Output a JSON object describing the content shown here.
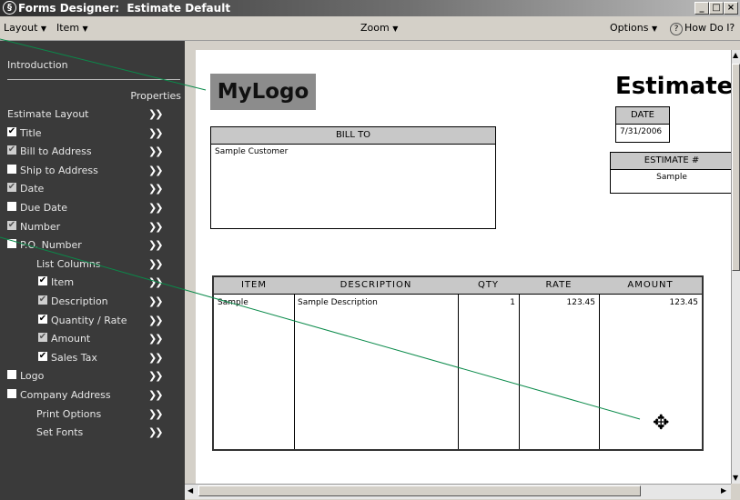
{
  "window": {
    "title": "Forms Designer:  Estimate Default",
    "min": "_",
    "max": "□",
    "close": "×"
  },
  "menubar": {
    "layout": "Layout",
    "item": "Item",
    "zoom": "Zoom",
    "options": "Options",
    "help": "How Do I?"
  },
  "sidebar": {
    "intro": "Introduction",
    "properties": "Properties",
    "items": [
      {
        "label": "Estimate Layout",
        "check": "none"
      },
      {
        "label": "Title",
        "check": "on"
      },
      {
        "label": "Bill to Address",
        "check": "dim"
      },
      {
        "label": "Ship to Address",
        "check": "off"
      },
      {
        "label": "Date",
        "check": "dim"
      },
      {
        "label": "Due Date",
        "check": "off"
      },
      {
        "label": "Number",
        "check": "dim"
      },
      {
        "label": "P.O. Number",
        "check": "off"
      },
      {
        "label": "List Columns",
        "check": "none"
      },
      {
        "label": "Item",
        "check": "on"
      },
      {
        "label": "Description",
        "check": "dim"
      },
      {
        "label": "Quantity / Rate",
        "check": "on"
      },
      {
        "label": "Amount",
        "check": "dim"
      },
      {
        "label": "Sales Tax",
        "check": "on"
      },
      {
        "label": "Logo",
        "check": "off"
      },
      {
        "label": "Company Address",
        "check": "off"
      },
      {
        "label": "Print Options",
        "check": "none"
      },
      {
        "label": "Set Fonts",
        "check": "none"
      }
    ]
  },
  "form": {
    "logo": "MyLogo",
    "title": "Estimate",
    "date_label": "DATE",
    "date_value": "7/31/2006",
    "estnum_label": "ESTIMATE #",
    "estnum_value": "Sample",
    "billto_label": "BILL TO",
    "billto_value": "Sample Customer",
    "columns": [
      {
        "label": "ITEM",
        "value": "Sample",
        "align": "left"
      },
      {
        "label": "DESCRIPTION",
        "value": "Sample Description",
        "align": "left"
      },
      {
        "label": "QTY",
        "value": "1",
        "align": "right"
      },
      {
        "label": "RATE",
        "value": "123.45",
        "align": "right"
      },
      {
        "label": "AMOUNT",
        "value": "123.45",
        "align": "right"
      }
    ]
  },
  "colors": {
    "sidebar_bg": "#3a3a3a",
    "header_fill": "#c8c8c8",
    "logo_fill": "#8c8c8c",
    "pointer_line": "#0a8a4a"
  },
  "icons": {
    "app": "gear-circle-icon",
    "chevron": "double-chevron-right-icon",
    "cursor": "move-cursor-icon"
  }
}
